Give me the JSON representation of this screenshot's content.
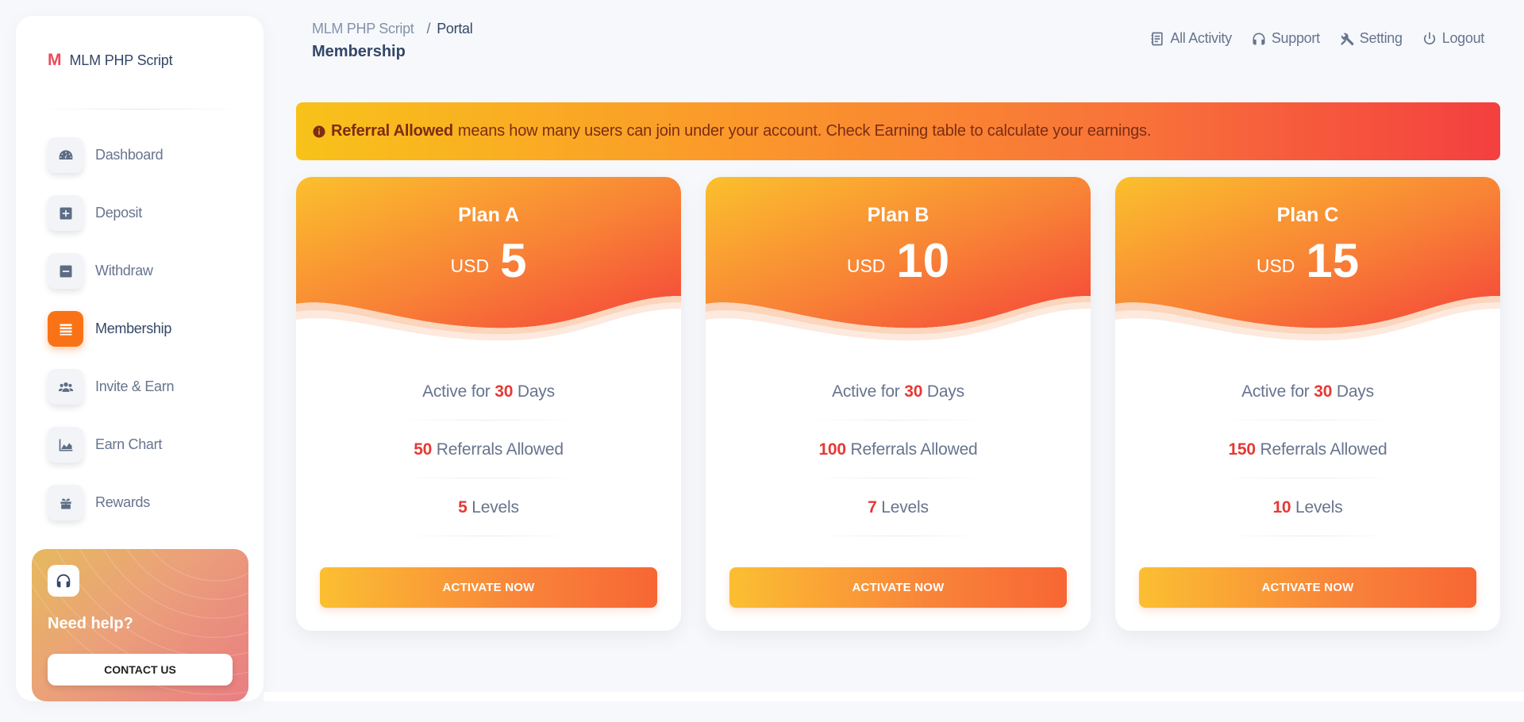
{
  "brand": {
    "logo": "M",
    "name": "MLM PHP Script"
  },
  "sidebar": {
    "items": [
      {
        "label": "Dashboard",
        "icon": "dashboard-icon"
      },
      {
        "label": "Deposit",
        "icon": "plus-square-icon"
      },
      {
        "label": "Withdraw",
        "icon": "minus-square-icon"
      },
      {
        "label": "Membership",
        "icon": "list-icon"
      },
      {
        "label": "Invite & Earn",
        "icon": "users-icon"
      },
      {
        "label": "Earn Chart",
        "icon": "area-chart-icon"
      },
      {
        "label": "Rewards",
        "icon": "gift-icon"
      }
    ],
    "active": "Membership",
    "help": {
      "title": "Need help?",
      "button": "CONTACT US"
    }
  },
  "header": {
    "breadcrumb": {
      "root": "MLM PHP Script",
      "separator": "/",
      "current": "Portal"
    },
    "title": "Membership",
    "nav": [
      {
        "label": "All Activity",
        "icon": "activity-icon"
      },
      {
        "label": "Support",
        "icon": "headphones-icon"
      },
      {
        "label": "Setting",
        "icon": "tools-icon"
      },
      {
        "label": "Logout",
        "icon": "power-icon"
      }
    ]
  },
  "alert": {
    "strong": "Referral Allowed",
    "text": "means how many users can join under your account. Check Earning table to calculate your earnings."
  },
  "plans": [
    {
      "name": "Plan A",
      "currency": "USD",
      "price": "5",
      "days_prefix": "Active for",
      "days": "30",
      "days_suffix": "Days",
      "referrals": "50",
      "referrals_suffix": "Referrals Allowed",
      "levels": "5",
      "levels_suffix": "Levels",
      "button": "ACTIVATE NOW"
    },
    {
      "name": "Plan B",
      "currency": "USD",
      "price": "10",
      "days_prefix": "Active for",
      "days": "30",
      "days_suffix": "Days",
      "referrals": "100",
      "referrals_suffix": "Referrals Allowed",
      "levels": "7",
      "levels_suffix": "Levels",
      "button": "ACTIVATE NOW"
    },
    {
      "name": "Plan C",
      "currency": "USD",
      "price": "15",
      "days_prefix": "Active for",
      "days": "30",
      "days_suffix": "Days",
      "referrals": "150",
      "referrals_suffix": "Referrals Allowed",
      "levels": "10",
      "levels_suffix": "Levels",
      "button": "ACTIVATE NOW"
    }
  ],
  "colors": {
    "accent": "#f97316",
    "highlight": "#e53935",
    "gradient_start": "#fbc02d",
    "gradient_end": "#f44336"
  }
}
